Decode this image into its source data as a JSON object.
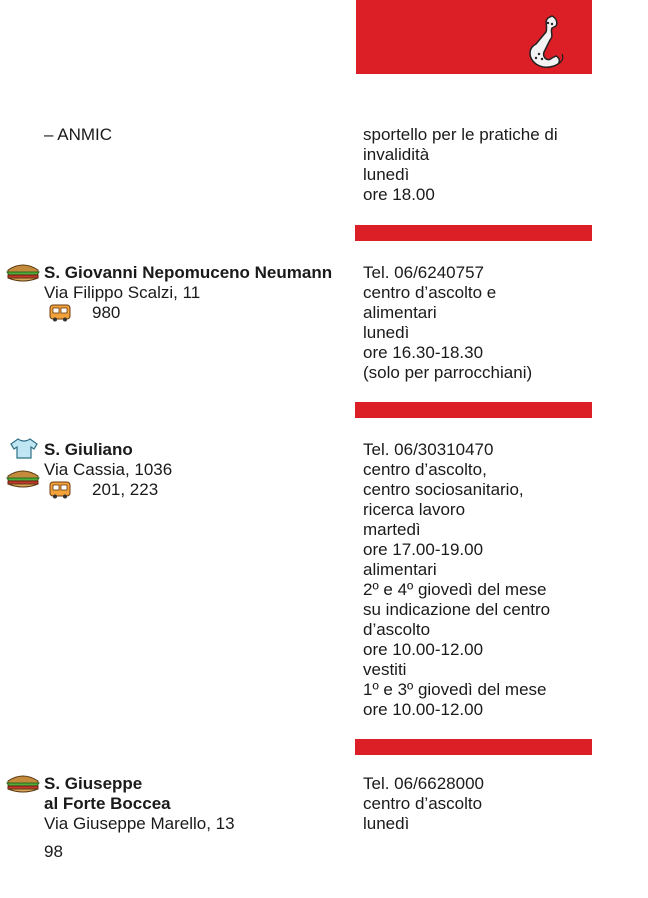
{
  "header": {
    "icon": "telephone-icon",
    "color": "#dc1f26"
  },
  "entries": [
    {
      "left": {
        "title": "– ANMIC"
      },
      "right": [
        "sportello per le pratiche di",
        "invalidità",
        "lunedì",
        "ore 18.00"
      ]
    },
    {
      "left": {
        "name": "S. Giovanni Nepomuceno Neumann",
        "address": "Via Filippo Scalzi, 11",
        "bus": "980",
        "icons": [
          "food-icon"
        ]
      },
      "right": [
        "Tel. 06/6240757",
        "centro d’ascolto e",
        "alimentari",
        "lunedì",
        "ore 16.30-18.30",
        "(solo per parrocchiani)"
      ]
    },
    {
      "left": {
        "name": "S. Giuliano",
        "address": "Via Cassia, 1036",
        "bus": "201, 223",
        "icons": [
          "clothing-icon",
          "food-icon"
        ]
      },
      "right": [
        "Tel. 06/30310470",
        "centro d’ascolto,",
        "centro sociosanitario,",
        "ricerca lavoro",
        "martedì",
        "ore 17.00-19.00",
        "alimentari",
        "2º e 4º giovedì del mese",
        "su indicazione del centro",
        "d’ascolto",
        "ore 10.00-12.00",
        "vestiti",
        "1º e 3º giovedì del mese",
        "ore 10.00-12.00"
      ]
    },
    {
      "left": {
        "name_lines": [
          "S. Giuseppe",
          "al Forte Boccea"
        ],
        "address": "Via Giuseppe Marello, 13",
        "icons": [
          "food-icon"
        ]
      },
      "right": [
        "Tel. 06/6628000",
        "centro d’ascolto",
        "lunedì"
      ]
    }
  ],
  "page_number": "98"
}
